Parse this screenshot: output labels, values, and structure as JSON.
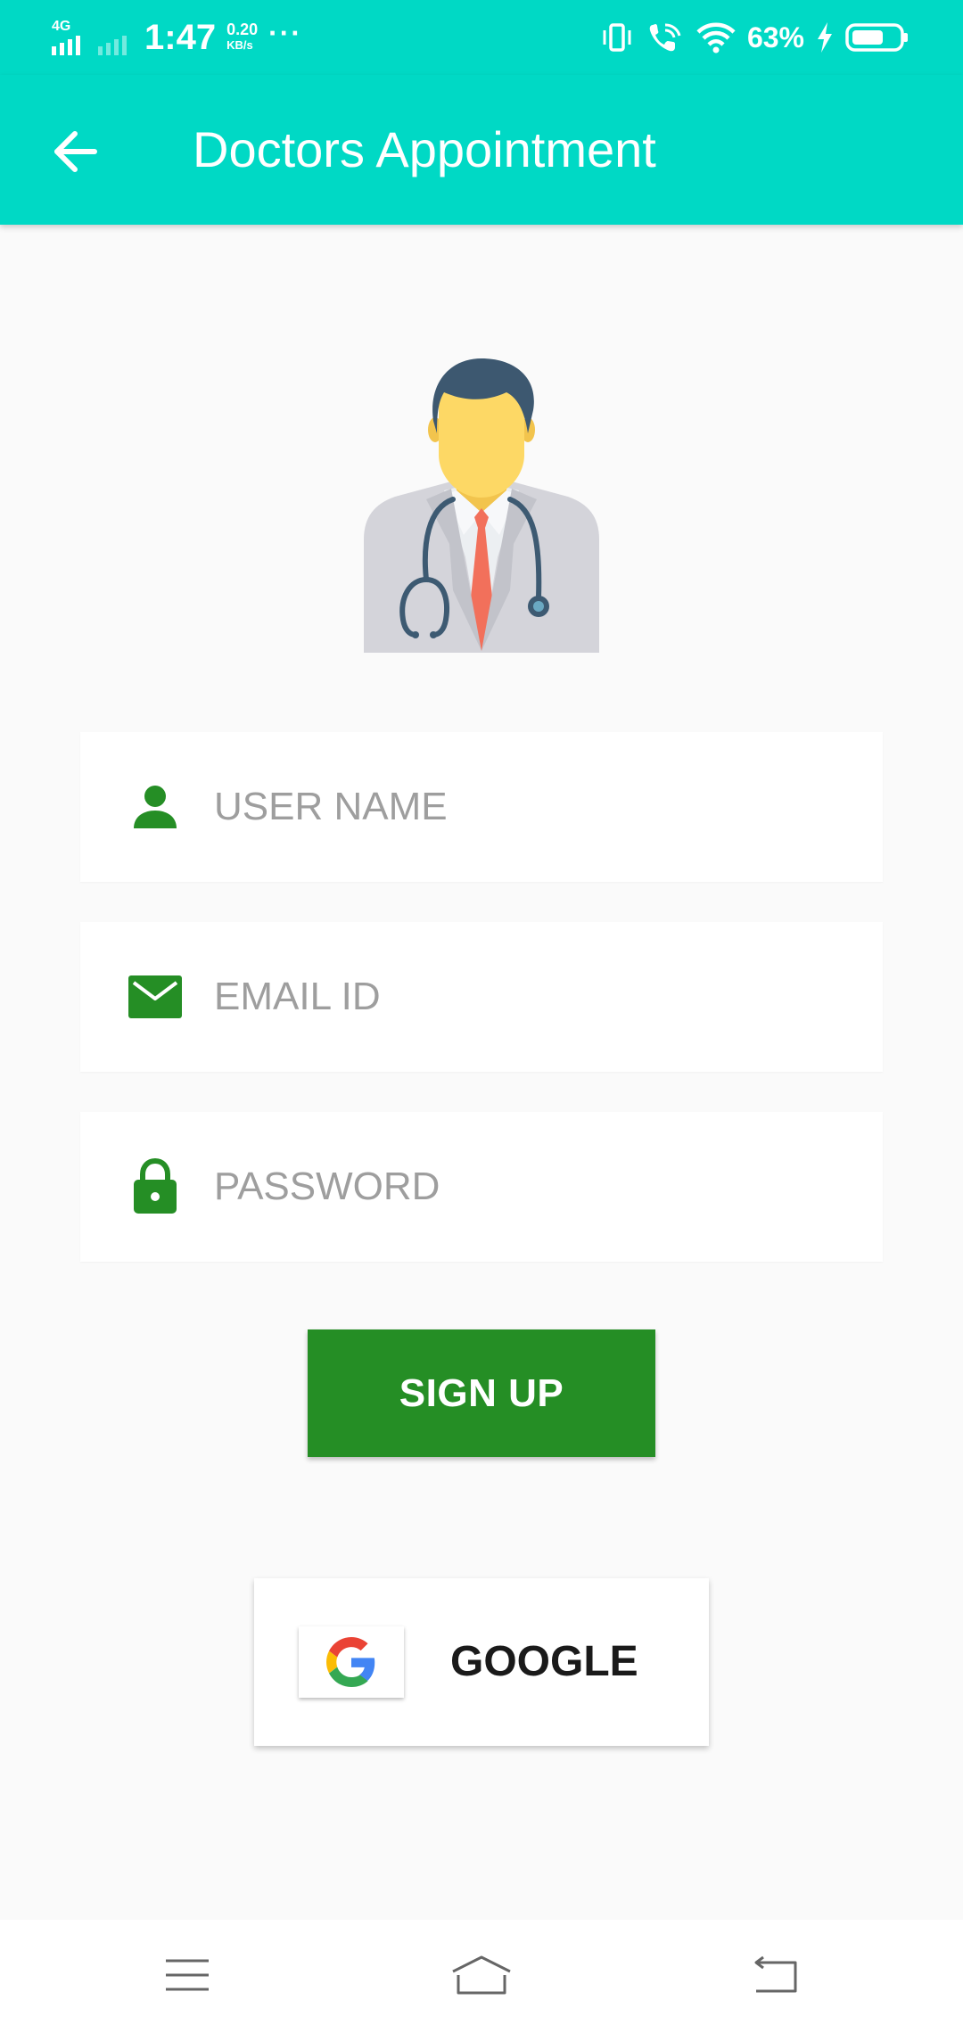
{
  "status_bar": {
    "network": "4G",
    "time": "1:47",
    "speed_value": "0.20",
    "speed_unit": "KB/s",
    "more": "···",
    "battery": "63%"
  },
  "app_bar": {
    "title": "Doctors Appointment"
  },
  "form": {
    "username_placeholder": "USER NAME",
    "email_placeholder": "EMAIL ID",
    "password_placeholder": "PASSWORD",
    "icon_color": "#258e25"
  },
  "actions": {
    "signup_label": "SIGN UP",
    "google_label": "GOOGLE"
  },
  "colors": {
    "primary": "#00d9c5",
    "accent_green": "#258e25",
    "background": "#fafafa"
  }
}
